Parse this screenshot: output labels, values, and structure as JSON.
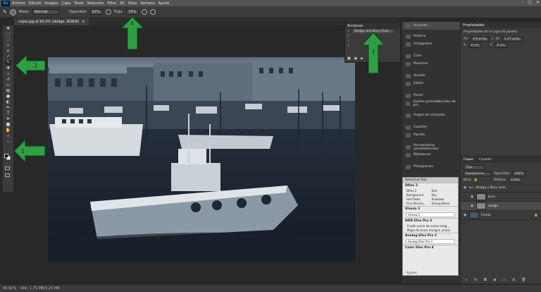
{
  "app": {
    "logo": "Ps"
  },
  "menu": {
    "items": [
      "Archivo",
      "Edición",
      "Imagen",
      "Capa",
      "Texto",
      "Selección",
      "Filtro",
      "3D",
      "Vista",
      "Ventana",
      "Ayuda"
    ]
  },
  "options_bar": {
    "mode_label": "Modo:",
    "mode_value": "Normal",
    "opacity_label": "Opacidad:",
    "opacity_value": "62%",
    "flow_label": "Flujo:",
    "flow_value": "75%"
  },
  "document_tab": {
    "title": "copia.jpg al 90,9% (dodge, RGB/8)",
    "close": "×"
  },
  "statusbar": {
    "zoom": "90,91%",
    "doc": "Doc: 1,75 MB/5,25 MB"
  },
  "actions_panel": {
    "title": "Acciones",
    "rows": [
      {
        "check": "✓",
        "label": "Dodge and Burn Auto..."
      },
      {
        "check": "✓",
        "label": ""
      },
      {
        "check": "✓",
        "label": ""
      },
      {
        "check": "✓",
        "label": ""
      }
    ]
  },
  "icon_panels": {
    "items": [
      "Acciones",
      "Historia",
      "Histograma",
      "Color",
      "Muestras",
      "Ajustes",
      "Estilos",
      "Pincel",
      "Ajustes preestablecidos de pin...",
      "Origen de clonación",
      "Carácter",
      "Párrafo",
      "Herramientas preestablecidas",
      "Bibliotecas",
      "Pictogramas"
    ]
  },
  "properties": {
    "title": "Propiedades",
    "subtitle": "Propiedades de la capa de píxeles",
    "an_label": "An:",
    "an_value": "4,9 pulg.",
    "al_label": "Al:",
    "al_value": "3,47 pulg.",
    "x_label": "X:",
    "x_value": "0 cm",
    "y_label": "Y:",
    "y_value": "0 cm"
  },
  "layers": {
    "tab_layers": "Capas",
    "tab_channels": "Canales",
    "filter": "Tipo",
    "blend": "Superponer",
    "opacity_label": "Opacidad:",
    "opacity_value": "100%",
    "lock_label": "Bloq:",
    "fill_label": "Relleno:",
    "fill_value": "100%",
    "rows": [
      {
        "name": "Dodge y Burn auto",
        "selected": false
      },
      {
        "name": "burn",
        "selected": false
      },
      {
        "name": "dodge",
        "selected": true
      },
      {
        "name": "Fondo",
        "selected": false
      }
    ]
  },
  "selective_tool": {
    "title": "Selective Tool",
    "group1": "Dfine 2",
    "cells": [
      "Dfine 2",
      "Size",
      "Background",
      "Sky",
      "Hot Pixels",
      "Shadows",
      "Fine Structu...",
      "Strong Noise"
    ],
    "group2": "Viveza 2",
    "viveza_box": "Viveza 2",
    "group3": "HDR Efex Pro 2",
    "hdr_lines": [
      "Fusión (serie de varias imág...",
      "Mapa de tonos (imagen única)"
    ],
    "group4": "Analog Efex Pro 2",
    "analog_box": "Analog Efex Pro 2",
    "group5": "Color Efex Pro 4",
    "footer": "Ajustes"
  },
  "annotations": {
    "arrow_labels": [
      "2",
      "3",
      "4",
      "1"
    ]
  },
  "colors": {
    "arrow": "#2ea043"
  }
}
